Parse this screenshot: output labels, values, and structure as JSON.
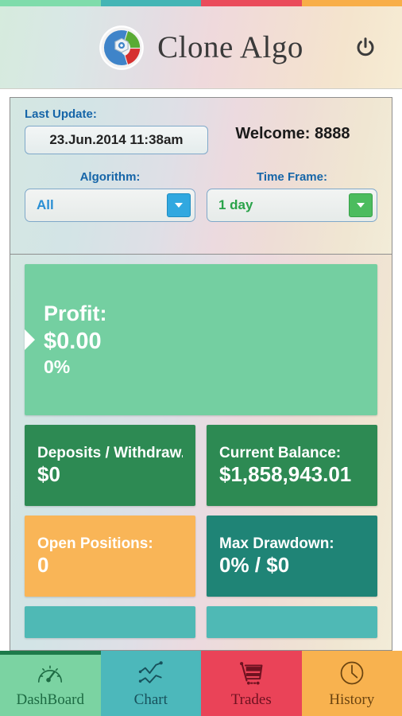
{
  "header": {
    "app_title": "Clone Algo",
    "logo_icon": "clone-algo-logo",
    "power_icon": "power-icon",
    "strip_colors": [
      "#7fdcab",
      "#44b5b5",
      "#ea4b5b",
      "#f8ae48"
    ]
  },
  "info_panel": {
    "last_update_label": "Last Update:",
    "last_update_value": "23.Jun.2014 11:38am",
    "welcome_text": "Welcome: 8888",
    "algorithm_label": "Algorithm:",
    "algorithm_value": "All",
    "algorithm_arrow_icon": "chevron-down-icon",
    "time_frame_label": "Time Frame:",
    "time_frame_value": "1 day",
    "time_frame_arrow_icon": "chevron-down-icon"
  },
  "cards": {
    "profit": {
      "title": "Profit:",
      "value": "$0.00",
      "sub": "0%",
      "color": "#74cfa1"
    },
    "deposits": {
      "title": "Deposits / Withdraw...",
      "value": "$0",
      "color": "#2d8a53"
    },
    "balance": {
      "title": "Current Balance:",
      "value": "$1,858,943.01",
      "color": "#2d8a53"
    },
    "open_positions": {
      "title": "Open Positions:",
      "value": "0",
      "color": "#f9b557"
    },
    "max_drawdown": {
      "title": "Max Drawdown:",
      "value": "0% / $0",
      "color": "#1f8476"
    },
    "clipped_left_color": "#4fb9b5",
    "clipped_right_color": "#4fb9b5"
  },
  "bottom_nav": {
    "items": [
      {
        "label": "DashBoard",
        "icon": "gauge-icon",
        "color": "#7bd3a2",
        "active": true
      },
      {
        "label": "Chart",
        "icon": "line-chart-icon",
        "color": "#4cb8bb",
        "active": false
      },
      {
        "label": "Trades",
        "icon": "shopping-cart-icon",
        "color": "#ea4358",
        "active": false
      },
      {
        "label": "History",
        "icon": "clock-icon",
        "color": "#f8b24f",
        "active": false
      }
    ]
  }
}
